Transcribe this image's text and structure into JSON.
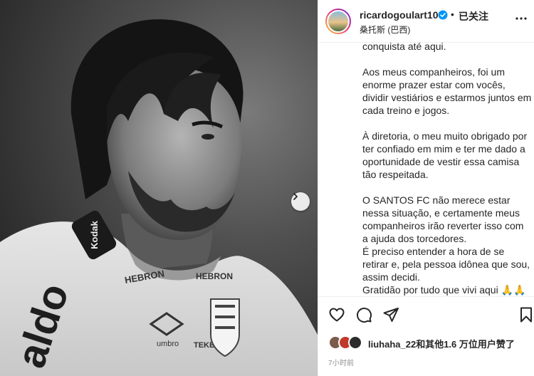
{
  "post": {
    "username": "ricardogoulart10",
    "separator": "•",
    "follow_status": "已关注",
    "location": "桑托斯 (巴西)"
  },
  "photo": {
    "jersey_sponsor": "Kodak",
    "jersey_text_1": "HEBRON",
    "jersey_text_2": "HEBRON",
    "jersey_brand": "umbro",
    "jersey_text_3": "TEKBOND",
    "jersey_side": "aldo"
  },
  "caption": {
    "p0": "conquista até aqui.",
    "p1": "Aos meus companheiros, foi um enorme prazer estar com vocês, dividir vestiários e estarmos juntos em cada treino e jogos.",
    "p2": "À diretoria, o meu muito obrigado por ter confiado em mim e ter me dado a oportunidade de vestir essa camisa tão respeitada.",
    "p3": "O SANTOS FC não merece estar nessa situação, e certamente meus companheiros irão reverter isso com a ajuda dos torcedores.",
    "p4": "É preciso entender a hora de se retirar e, pela pessoa idônea que sou, assim decidi.",
    "p5": "Gratidão por tudo que vivi aqui 🙏🙏"
  },
  "likes": {
    "liker_name": "liuhaha_22",
    "rest": "和其他1.6 万位用户赞了"
  },
  "timestamp": "7小时前",
  "icons": {
    "like": "heart-icon",
    "comment": "comment-icon",
    "share": "share-icon",
    "save": "bookmark-icon",
    "next": "chevron-right-icon",
    "more": "more-icon",
    "verified": "verified-badge-icon"
  },
  "colors": {
    "verified_blue": "#0095f6",
    "text": "#262626",
    "muted": "#8e8e8e"
  }
}
